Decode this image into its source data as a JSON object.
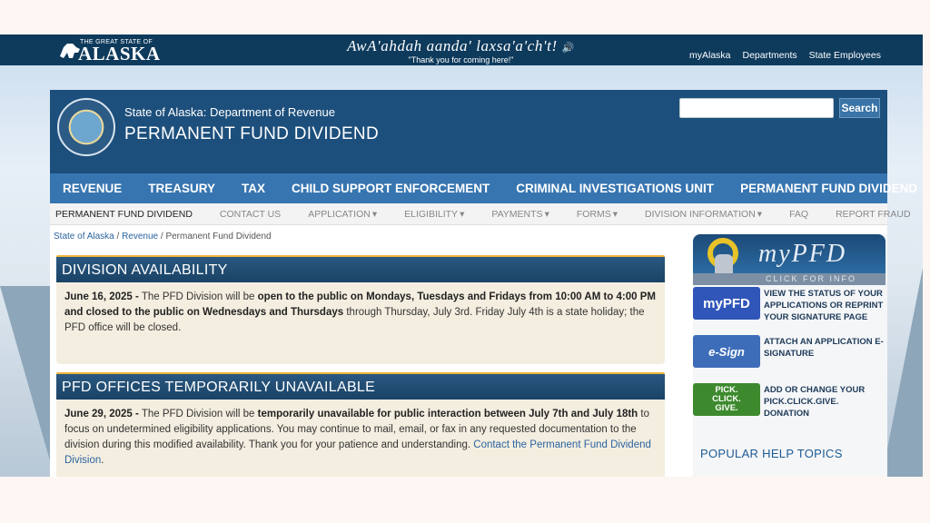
{
  "topbar": {
    "logo_small": "THE GREAT STATE OF",
    "logo_big": "ALASKA",
    "greeting_native": "AwA'ahdah aanda' laxsa'a'ch't!",
    "greeting_english": "\"Thank you for coming here!\"",
    "links": [
      "myAlaska",
      "Departments",
      "State Employees"
    ]
  },
  "header": {
    "dept": "State of Alaska: Department of Revenue",
    "title": "PERMANENT FUND DIVIDEND",
    "search_placeholder": "",
    "search_button": "Search"
  },
  "main_nav": [
    "REVENUE",
    "TREASURY",
    "TAX",
    "CHILD SUPPORT ENFORCEMENT",
    "CRIMINAL INVESTIGATIONS UNIT",
    "PERMANENT FUND DIVIDEND"
  ],
  "sub_nav": [
    "PERMANENT FUND DIVIDEND",
    "CONTACT US",
    "APPLICATION",
    "ELIGIBILITY",
    "PAYMENTS",
    "FORMS",
    "DIVISION INFORMATION",
    "FAQ",
    "REPORT FRAUD"
  ],
  "breadcrumb": {
    "items": [
      "State of Alaska",
      "Revenue"
    ],
    "sep": "/",
    "current": "Permanent Fund Dividend"
  },
  "sections": [
    {
      "heading": "DIVISION AVAILABILITY",
      "date": "June 16, 2025 -",
      "t1": " The PFD Division will be ",
      "b1": "open to the public on Mondays, Tuesdays and Fridays from 10:00 AM to 4:00 PM and closed to the public on Wednesdays and Thursdays",
      "t2": " through Thursday, July 3rd.  Friday July 4th is a state holiday; the PFD office will be closed."
    },
    {
      "heading": "PFD OFFICES TEMPORARILY UNAVAILABLE",
      "date": "June 29, 2025 -",
      "t1": " The PFD Division will be ",
      "b1": "temporarily unavailable for public interaction between July 7th and July 18th",
      "t2": " to focus on undetermined eligibility applications.  You may continue to mail, email, or fax in any requested documentation to the division during this modified availability.  Thank you for your patience and understanding.  ",
      "link": "Contact the Permanent Fund Dividend Division",
      "t3": "."
    }
  ],
  "sidebar": {
    "banner_logo": "myPFD",
    "banner_click": "CLICK FOR INFO",
    "items": [
      {
        "button": "myPFD",
        "text": "VIEW THE STATUS OF YOUR APPLICATIONS OR REPRINT YOUR SIGNATURE PAGE",
        "color": "#2f56b8"
      },
      {
        "button": "e-Sign",
        "text": "ATTACH AN APPLICATION E-SIGNATURE",
        "color": "#3d6db8"
      },
      {
        "button": "PICK. CLICK. GIVE.",
        "text": "ADD OR CHANGE YOUR PICK.CLICK.GIVE. DONATION",
        "color": "#3d8a2e"
      }
    ],
    "help_heading": "POPULAR HELP TOPICS"
  },
  "colors": {
    "header": "#1d4f7c",
    "nav": "#3775b0",
    "accent": "#f0b43c"
  }
}
